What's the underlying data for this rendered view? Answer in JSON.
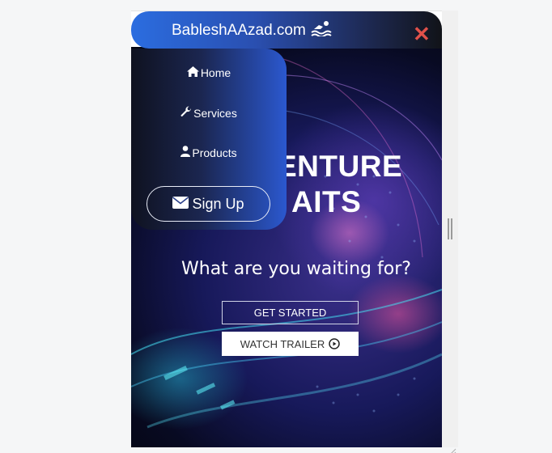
{
  "navbar": {
    "brand": "BableshAAzad.com",
    "brand_icon": "swimmer-icon",
    "close_icon": "close-icon",
    "close_color": "#e0514a"
  },
  "menu": {
    "items": [
      {
        "label": "Home",
        "icon": "home-icon"
      },
      {
        "label": "Services",
        "icon": "wrench-icon"
      },
      {
        "label": "Products",
        "icon": "user-icon"
      }
    ],
    "signup_label": "Sign Up",
    "signup_icon": "envelope-icon"
  },
  "hero": {
    "title_line1": "ENTURE",
    "title_line2": "AITS",
    "subtitle": "What are you waiting for?",
    "get_started_label": "GET STARTED",
    "watch_trailer_label": "WATCH TRAILER",
    "watch_trailer_icon": "play-circle-icon"
  },
  "colors": {
    "nav_start": "#2b6de0",
    "nav_end": "#111318",
    "accent": "#2b58cf"
  }
}
